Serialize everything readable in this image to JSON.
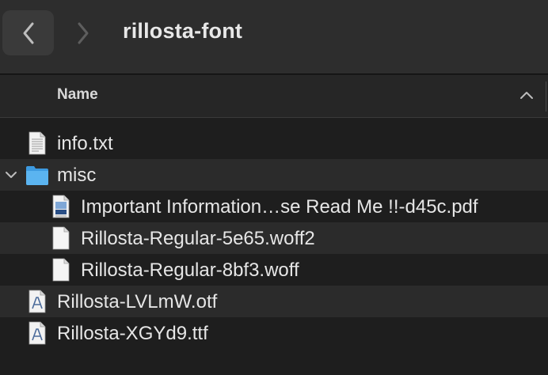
{
  "window": {
    "title": "rillosta-font"
  },
  "toolbar": {
    "back_icon": "chevron-left-icon",
    "forward_icon": "chevron-right-icon"
  },
  "header": {
    "name_column": "Name",
    "sort_icon": "chevron-up-icon"
  },
  "files": [
    {
      "name": "info.txt",
      "kind": "text",
      "icon": "text-document-icon",
      "level": 0
    },
    {
      "name": "misc",
      "kind": "folder",
      "icon": "folder-icon",
      "level": 0,
      "expanded": true
    },
    {
      "name": "Important Information…se Read Me !!-d45c.pdf",
      "kind": "pdf",
      "icon": "pdf-document-icon",
      "level": 1
    },
    {
      "name": "Rillosta-Regular-5e65.woff2",
      "kind": "blank",
      "icon": "blank-document-icon",
      "level": 1
    },
    {
      "name": "Rillosta-Regular-8bf3.woff",
      "kind": "blank",
      "icon": "blank-document-icon",
      "level": 1
    },
    {
      "name": "Rillosta-LVLmW.otf",
      "kind": "font",
      "icon": "font-document-icon",
      "level": 0
    },
    {
      "name": "Rillosta-XGYd9.ttf",
      "kind": "font",
      "icon": "font-document-icon",
      "level": 0
    }
  ],
  "colors": {
    "background": "#1e1e1e",
    "toolbar": "#2d2d2d",
    "alt_row": "#2b2b2b",
    "folder_blue": "#4aa8e8"
  }
}
